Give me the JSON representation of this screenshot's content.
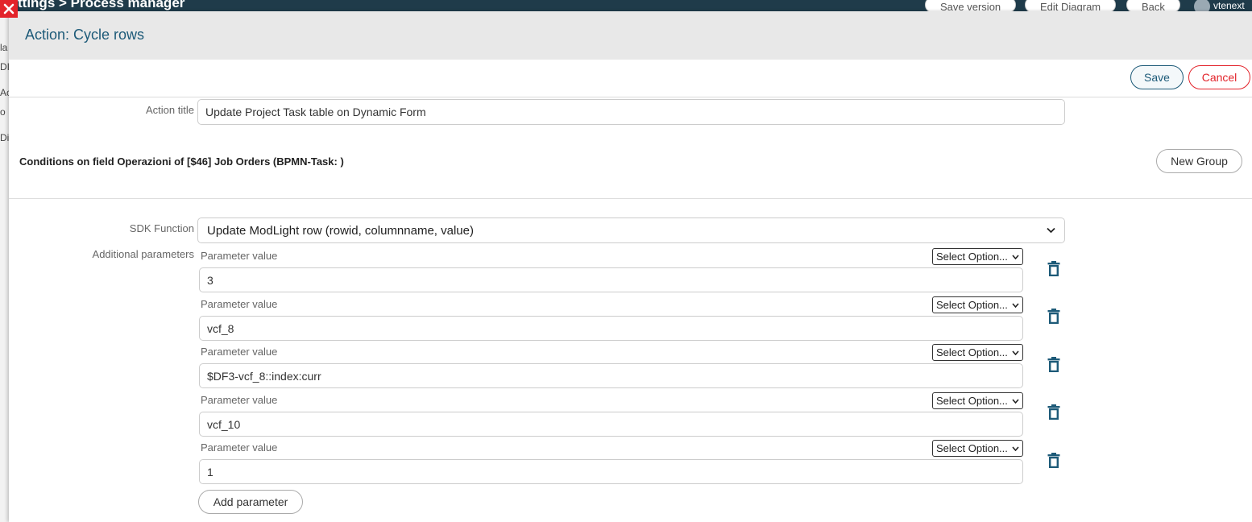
{
  "background": {
    "title": "ttings > Process manager",
    "buttons": [
      "Save version",
      "Edit Diagram",
      "Back"
    ],
    "user": "vtenext",
    "left_labels": [
      "la",
      "DI",
      "Act",
      "o",
      "Dia"
    ]
  },
  "modal": {
    "title": "Action: Cycle rows",
    "save_label": "Save",
    "cancel_label": "Cancel"
  },
  "action_title": {
    "label": "Action title",
    "value": "Update Project Task table on Dynamic Form"
  },
  "conditions": {
    "title": "Conditions on field Operazioni of [$46] Job Orders (BPMN-Task: )",
    "new_group_label": "New Group"
  },
  "sdk_function": {
    "label": "SDK Function",
    "value": "Update ModLight row (rowid, columnname, value)"
  },
  "additional_parameters": {
    "label": "Additional parameters",
    "params": [
      {
        "label": "Parameter value",
        "option": "Select Option...",
        "value": "3"
      },
      {
        "label": "Parameter value",
        "option": "Select Option...",
        "value": "vcf_8"
      },
      {
        "label": "Parameter value",
        "option": "Select Option...",
        "value": "$DF3-vcf_8::index:curr"
      },
      {
        "label": "Parameter value",
        "option": "Select Option...",
        "value": "vcf_10"
      },
      {
        "label": "Parameter value",
        "option": "Select Option...",
        "value": "1"
      }
    ],
    "add_label": "Add parameter"
  },
  "colors": {
    "accent": "#1d5a78",
    "danger": "#e3242b",
    "header_bg": "#e8e8e8"
  }
}
